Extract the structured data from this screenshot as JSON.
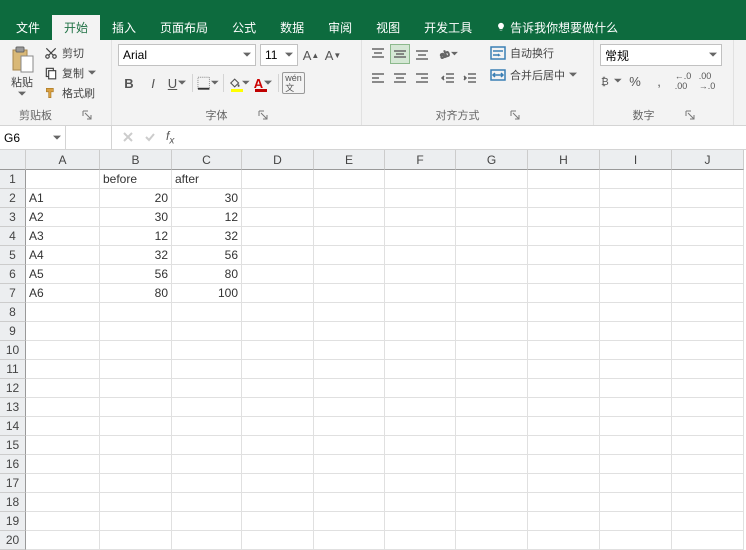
{
  "tabs": {
    "file": "文件",
    "home": "开始",
    "insert": "插入",
    "layout": "页面布局",
    "formulas": "公式",
    "data": "数据",
    "review": "审阅",
    "view": "视图",
    "dev": "开发工具",
    "tell": "告诉我你想要做什么"
  },
  "clipboard": {
    "paste": "粘贴",
    "cut": "剪切",
    "copy": "复制",
    "format_painter": "格式刷",
    "label": "剪贴板"
  },
  "font": {
    "name": "Arial",
    "size": "11",
    "label": "字体",
    "wen": "wén"
  },
  "align": {
    "wrap": "自动换行",
    "merge": "合并后居中",
    "label": "对齐方式"
  },
  "number": {
    "format": "常规",
    "label": "数字",
    "percent": "%",
    "comma": ",",
    "inc": ".0",
    "dec": ".00"
  },
  "namebox": "G6",
  "columns": [
    "A",
    "B",
    "C",
    "D",
    "E",
    "F",
    "G",
    "H",
    "I",
    "J"
  ],
  "rows": [
    "1",
    "2",
    "3",
    "4",
    "5",
    "6",
    "7",
    "8",
    "9",
    "10",
    "11",
    "12",
    "13",
    "14",
    "15",
    "16",
    "17",
    "18",
    "19",
    "20"
  ],
  "chart_data": {
    "type": "table",
    "headers": [
      "",
      "before",
      "after"
    ],
    "rows": [
      [
        "A1",
        20,
        30
      ],
      [
        "A2",
        30,
        12
      ],
      [
        "A3",
        12,
        32
      ],
      [
        "A4",
        32,
        56
      ],
      [
        "A5",
        56,
        80
      ],
      [
        "A6",
        80,
        100
      ]
    ]
  }
}
